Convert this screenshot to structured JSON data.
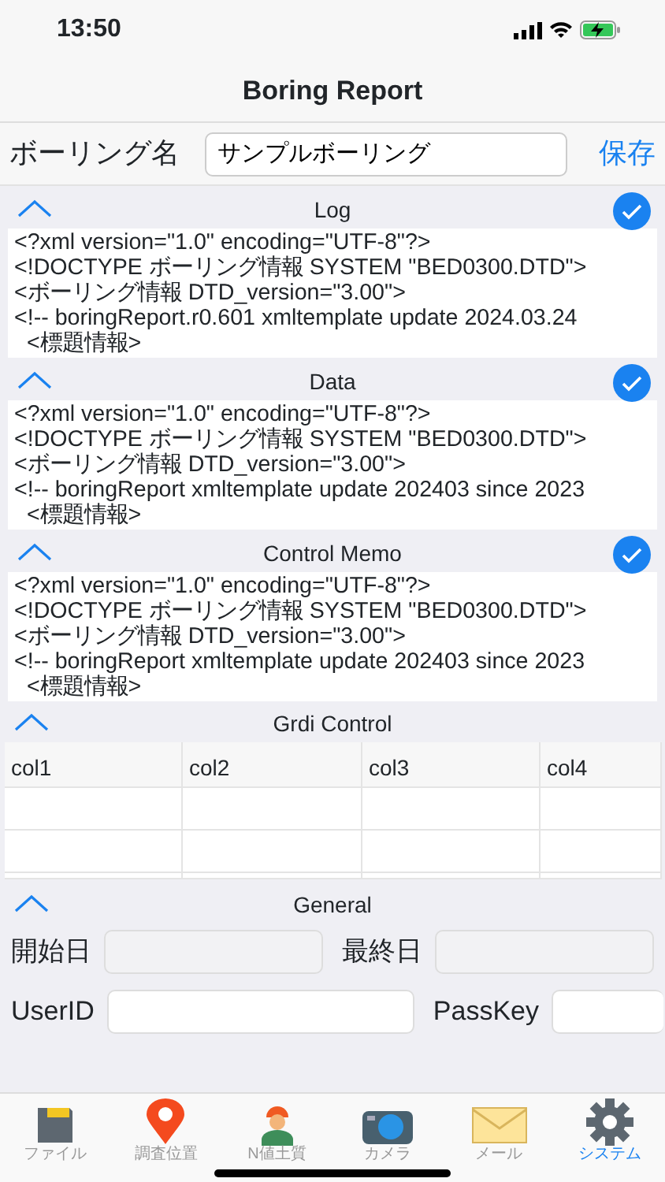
{
  "status_bar": {
    "time": "13:50"
  },
  "nav_bar": {
    "title": "Boring Report"
  },
  "name_row": {
    "label": "ボーリング名",
    "value": "サンプルボーリング",
    "save": "保存"
  },
  "sections": [
    {
      "title": "Log",
      "expanded": true,
      "checked": true,
      "lines": [
        "<?xml version=\"1.0\" encoding=\"UTF-8\"?>",
        "<!DOCTYPE ボーリング情報 SYSTEM \"BED0300.DTD\">",
        "<ボーリング情報 DTD_version=\"3.00\">",
        "<!-- boringReport.r0.601 xmltemplate update 2024.03.24",
        "  <標題情報>"
      ]
    },
    {
      "title": "Data",
      "expanded": true,
      "checked": true,
      "lines": [
        "<?xml version=\"1.0\" encoding=\"UTF-8\"?>",
        "<!DOCTYPE ボーリング情報 SYSTEM \"BED0300.DTD\">",
        "<ボーリング情報 DTD_version=\"3.00\">",
        "<!-- boringReport xmltemplate update 202403 since 2023",
        "  <標題情報>"
      ]
    },
    {
      "title": "Control Memo",
      "expanded": true,
      "checked": true,
      "lines": [
        "<?xml version=\"1.0\" encoding=\"UTF-8\"?>",
        "<!DOCTYPE ボーリング情報 SYSTEM \"BED0300.DTD\">",
        "<ボーリング情報 DTD_version=\"3.00\">",
        "<!-- boringReport xmltemplate update 202403 since 2023",
        "  <標題情報>"
      ]
    }
  ],
  "grid": {
    "title": "Grdi Control",
    "expanded": true,
    "columns": [
      "col1",
      "col2",
      "col3",
      "col4"
    ]
  },
  "general": {
    "title": "General",
    "expanded": true,
    "rows": [
      [
        {
          "label": "開始日",
          "disabled": true
        },
        {
          "label": "最終日",
          "disabled": true
        }
      ],
      [
        {
          "label": "UserID",
          "disabled": false
        },
        {
          "label": "PassKey",
          "disabled": false
        }
      ]
    ]
  },
  "tab_bar": [
    {
      "label": "ファイル",
      "kind": "card",
      "selected": false
    },
    {
      "label": "調査位置",
      "kind": "pin",
      "selected": false
    },
    {
      "label": "N値土質",
      "kind": "worker",
      "selected": false
    },
    {
      "label": "カメラ",
      "kind": "camera",
      "selected": false
    },
    {
      "label": "メール",
      "kind": "mail",
      "selected": false
    },
    {
      "label": "システム",
      "kind": "gear",
      "selected": true
    }
  ]
}
